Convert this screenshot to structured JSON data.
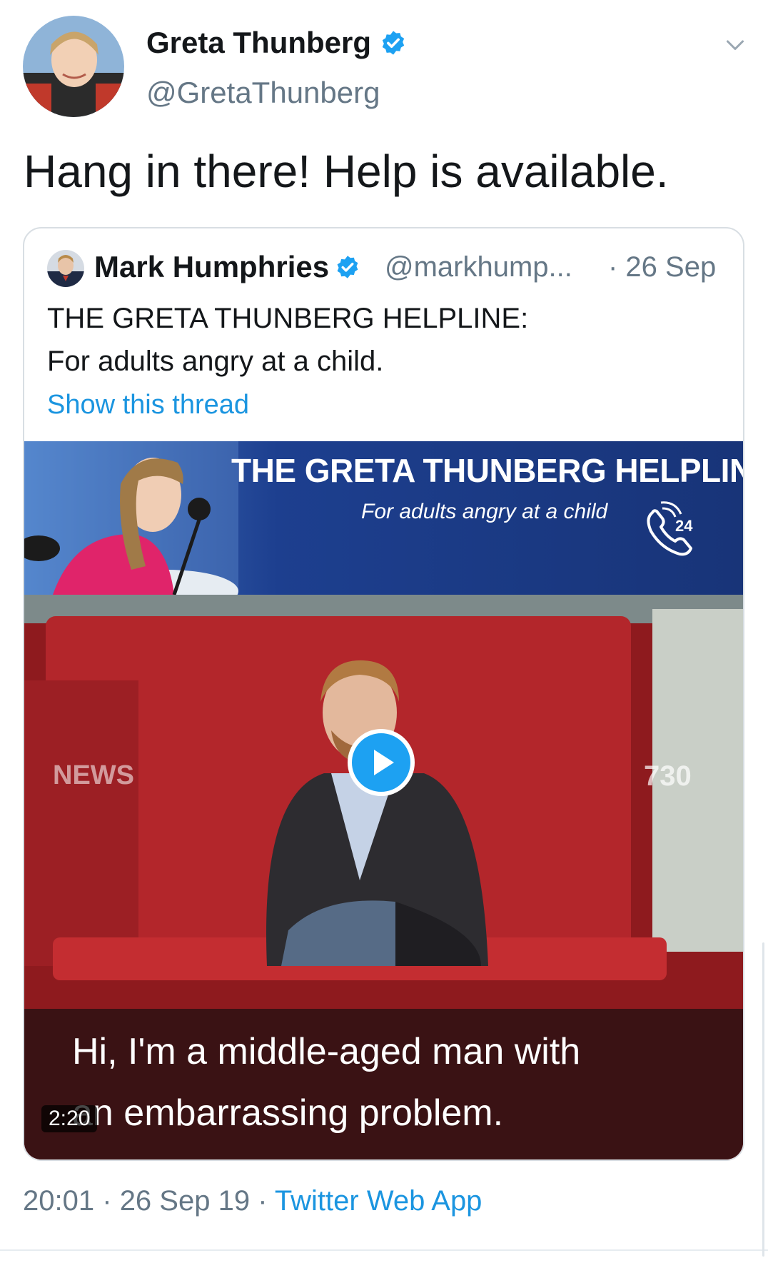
{
  "tweet": {
    "author_name": "Greta Thunberg",
    "author_handle": "@GretaThunberg",
    "text": "Hang in there! Help is available.",
    "time": "20:01",
    "date": "26 Sep 19",
    "separator": "·",
    "source": "Twitter Web App"
  },
  "quote": {
    "author_name": "Mark Humphries",
    "author_handle": "@markhump...",
    "date": "· 26 Sep",
    "line1": "THE GRETA THUNBERG HELPLINE:",
    "line2": "For adults angry at a child.",
    "show_thread": "Show this thread"
  },
  "media": {
    "banner_title": "THE GRETA THUNBERG HELPLINE",
    "banner_subtitle": "For adults angry at a child",
    "phone_badge": "24",
    "channel_logo": "NEWS",
    "program_logo": "730",
    "caption_line1": "Hi, I'm a middle-aged man with",
    "caption_line2": "an embarrassing problem.",
    "duration": "2:20"
  },
  "colors": {
    "link_blue": "#1b95e0",
    "verified_blue": "#1da1f2",
    "secondary_gray": "#657786"
  },
  "icons": [
    "verified-badge-icon",
    "chevron-down-icon",
    "phone-24-icon",
    "play-icon"
  ]
}
